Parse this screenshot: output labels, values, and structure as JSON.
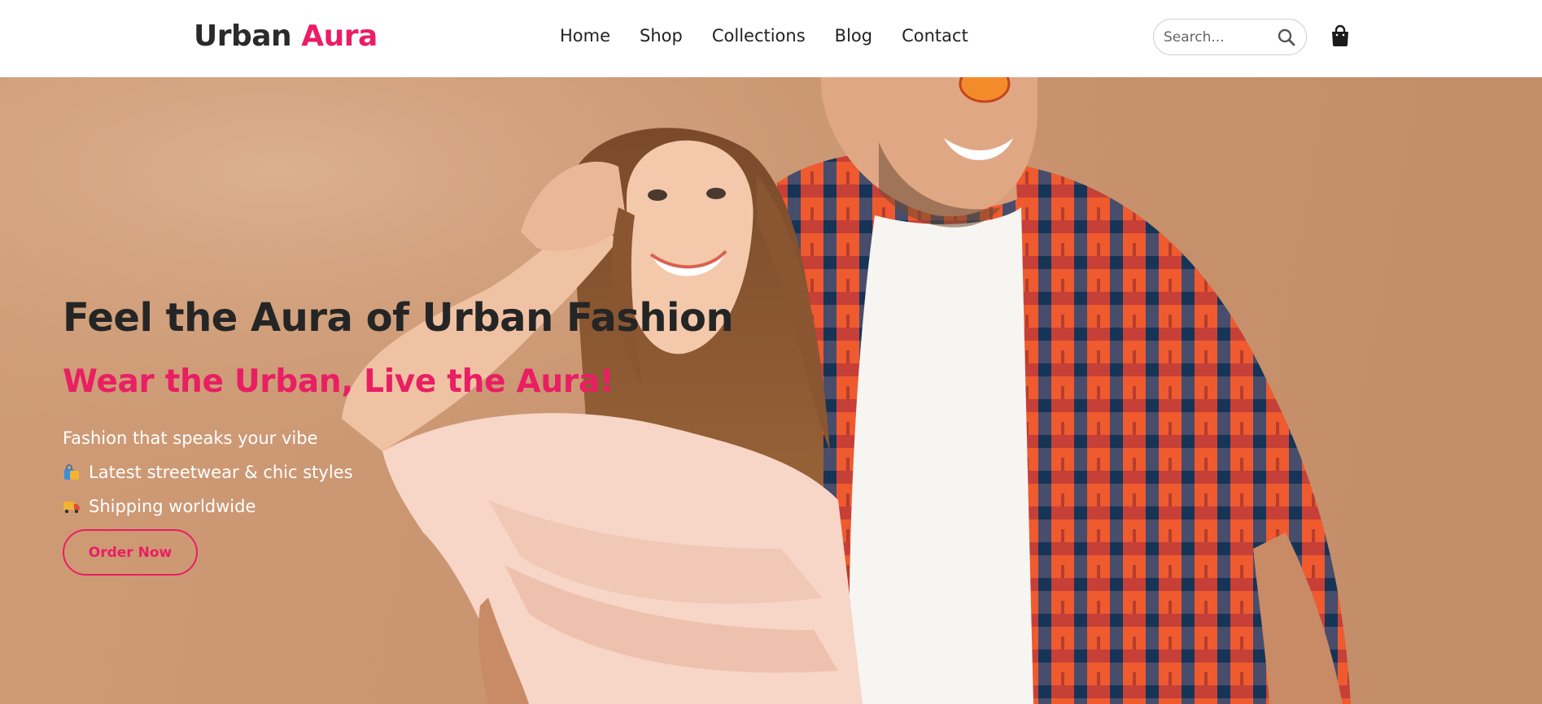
{
  "header": {
    "logo_primary": "Urban",
    "logo_accent": "Aura",
    "nav": [
      {
        "label": "Home"
      },
      {
        "label": "Shop"
      },
      {
        "label": "Collections"
      },
      {
        "label": "Blog"
      },
      {
        "label": "Contact"
      }
    ],
    "search": {
      "placeholder": "Search...",
      "value": "",
      "icon": "search-icon"
    },
    "cart_icon": "shopping-bag-icon"
  },
  "hero": {
    "headline": "Feel the Aura of Urban Fashion",
    "tagline": "Wear the Urban, Live the Aura!",
    "line1": "Fashion that speaks your vibe",
    "line2": "Latest streetwear & chic styles",
    "line2_icon": "shopping-bags-emoji-icon",
    "line3": "Shipping worldwide",
    "line3_icon": "delivery-truck-emoji-icon",
    "cta_label": "Order Now"
  },
  "colors": {
    "accent": "#e91e63",
    "text_dark": "#252525",
    "hero_background": "#c99470",
    "header_background": "#ffffff"
  }
}
